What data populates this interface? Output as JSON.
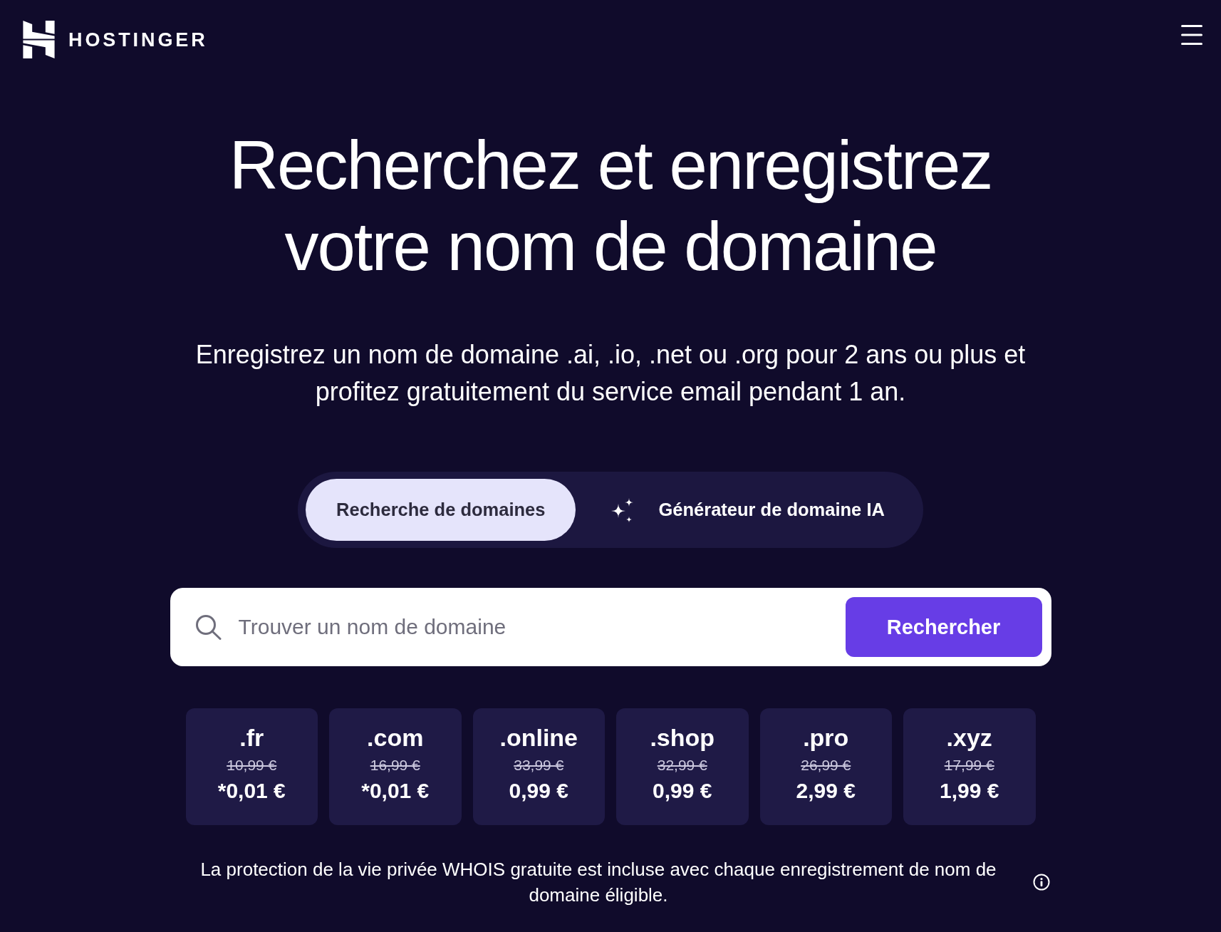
{
  "header": {
    "logo_text": "HOSTINGER"
  },
  "hero": {
    "title": "Recherchez et enregistrez votre nom de domaine",
    "subtitle": "Enregistrez un nom de domaine .ai, .io, .net ou .org pour 2 ans ou plus et profitez gratuitement du service email pendant 1 an."
  },
  "tabs": [
    {
      "label": "Recherche de domaines",
      "selected": true,
      "kind": "plain"
    },
    {
      "label": "Générateur de domaine IA",
      "selected": false,
      "kind": "ai"
    }
  ],
  "search": {
    "placeholder": "Trouver un nom de domaine",
    "button": "Rechercher"
  },
  "tlds": [
    {
      "name": ".fr",
      "old_price": "10,99 €",
      "price": "*0,01 €"
    },
    {
      "name": ".com",
      "old_price": "16,99 €",
      "price": "*0,01 €"
    },
    {
      "name": ".online",
      "old_price": "33,99 €",
      "price": "0,99 €"
    },
    {
      "name": ".shop",
      "old_price": "32,99 €",
      "price": "0,99 €"
    },
    {
      "name": ".pro",
      "old_price": "26,99 €",
      "price": "2,99 €"
    },
    {
      "name": ".xyz",
      "old_price": "17,99 €",
      "price": "1,99 €"
    }
  ],
  "footer_note": "La protection de la vie privée WHOIS gratuite est incluse avec chaque enregistrement de nom de domaine éligible."
}
